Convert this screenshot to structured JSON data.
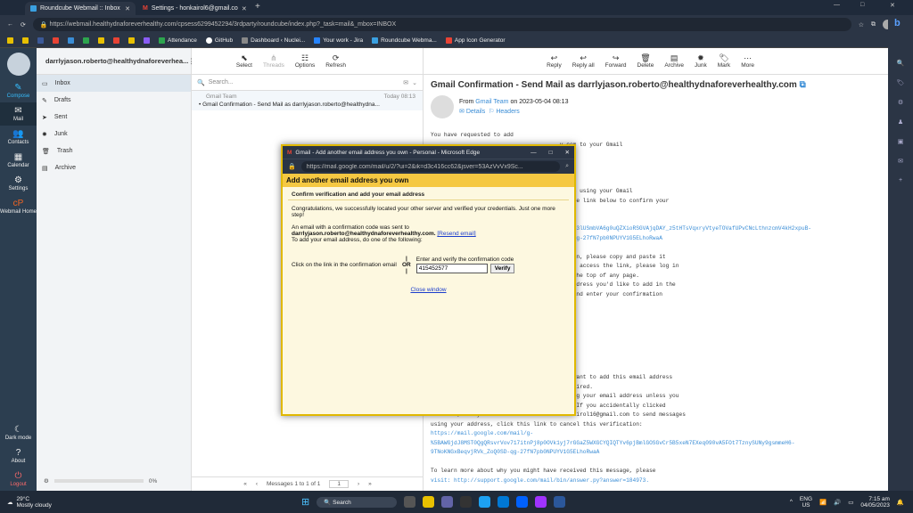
{
  "browser": {
    "tabs": [
      {
        "label": "Roundcube Webmail :: Inbox"
      },
      {
        "label": "Settings - honkairol6@gmail.co"
      }
    ],
    "url": "https://webmail.healthydnaforeverhealthy.com/cpsess6299452294/3rdparty/roundcube/index.php?_task=mail&_mbox=INBOX",
    "bookmarks": [
      "Attendance",
      "GitHub",
      "Dashboard ‹ Nuclei...",
      "Your work - Jira",
      "Roundcube Webma...",
      "App Icon Generator"
    ]
  },
  "nav": [
    {
      "label": "Compose"
    },
    {
      "label": "Mail"
    },
    {
      "label": "Contacts"
    },
    {
      "label": "Calendar"
    },
    {
      "label": "Settings"
    },
    {
      "label": "Webmail Home"
    }
  ],
  "nav_bottom": [
    {
      "label": "Dark mode"
    },
    {
      "label": "About"
    },
    {
      "label": "Logout"
    }
  ],
  "account": "darrlyjason.roberto@healthydnaforeverhea...",
  "folders": [
    "Inbox",
    "Drafts",
    "Sent",
    "Junk",
    "Trash",
    "Archive"
  ],
  "quota": "0%",
  "list_toolbar": [
    "Select",
    "Threads",
    "Options",
    "Refresh"
  ],
  "search_placeholder": "Search...",
  "message": {
    "from": "Gmail Team",
    "date": "Today 08:13",
    "subject": "Gmail Confirmation - Send Mail as darrlyjason.roberto@healthydna..."
  },
  "list_footer": {
    "count": "Messages 1 to 1 of 1",
    "page": "1"
  },
  "content_toolbar": [
    "Reply",
    "Reply all",
    "Forward",
    "Delete",
    "Archive",
    "Junk",
    "Mark",
    "More"
  ],
  "email": {
    "subject": "Gmail Confirmation - Send Mail as darrlyjason.roberto@healthydnaforeverhealthy.com",
    "from_prefix": "From",
    "from": "Gmail Team",
    "on": "on 2023-05-04 08:13",
    "details": "Details",
    "headers": "Headers",
    "body_lines": [
      "You have requested to add",
      "                                       y.com to your Gmail",
      "",
      "",
      "",
      "",
      "                                       y.com using your Gmail",
      "                                       ck the link below to confirm your",
      "",
      "",
      "                                       8HDQF3lUSmbVA6g0uQZXioRSGVAjqDAY_z5tHTsVqxryVtyeTOVafUPvCNcLthnzcmV4kH2xpuB-",
      "                                       OSD-qg-27fN7pb0NPUYV1G5ELhoRwaA",
      "",
      "                                       broken, please copy and paste it",
      "                                       le to access the link, please log in",
      "                                        at the top of any page.",
      "                                       il address you'd like to add in the",
      "                                       y,' and enter your confirmation"
    ],
    "body_lines2": [
      "                                       n't want to add this email address",
      "                                        required.",
      "                                        using your email address unless you",
      "                                       ove. If you accidentally clicked",
      "the link, but you do not want to allow honkairol16@gmail.com to send messages",
      "using your address, click this link to cancel this verification:",
      "https://mail.google.com/mail/g-",
      "%5BAWGjdJ8MST0QgQRsvrVov717itnPj8p0OVk1yj7rGGaZ5WXGCYQIQTYv6pjBmlGOSGvCr5B5xeN7EXeq090vA5FOt7TznySUNy9gsmmeH6-",
      "9TNoKNGxBeqvjRVk_ZoQ0SD-qg-27fN7pb0NPUYV1G5ELhoRwaA",
      "",
      "To learn more about why you might have received this message, please",
      "visit: http://support.google.com/mail/bin/answer.py?answer=184973."
    ]
  },
  "popup": {
    "title": "Gmail - Add another email address you own - Personal - Microsoft Edge",
    "url": "https://mail.google.com/mail/u/2/?ui=2&ik=d3c416cc62&jsver=53AzVvVx9Sc...",
    "header": "Add another email address you own",
    "subheader": "Confirm verification and add your email address",
    "congrats": "Congratulations, we successfully located your other server and verified your credentials. Just one more step!",
    "sent_to": "An email with a confirmation code was sent to",
    "email": "darrlyjason.roberto@healthydnaforeverhealthy.com.",
    "resend": "[Resend email]",
    "instruction": "To add your email address, do one of the following:",
    "option_link": "Click on the link in the confirmation email",
    "or": "OR",
    "option_code": "Enter and verify the confirmation code",
    "code": "415452577",
    "verify": "Verify",
    "close": "Close window"
  },
  "taskbar": {
    "temp": "29°C",
    "weather": "Mostly cloudy",
    "search": "Search",
    "lang": "ENG",
    "region": "US",
    "time": "7:15 am",
    "date": "04/05/2023"
  }
}
